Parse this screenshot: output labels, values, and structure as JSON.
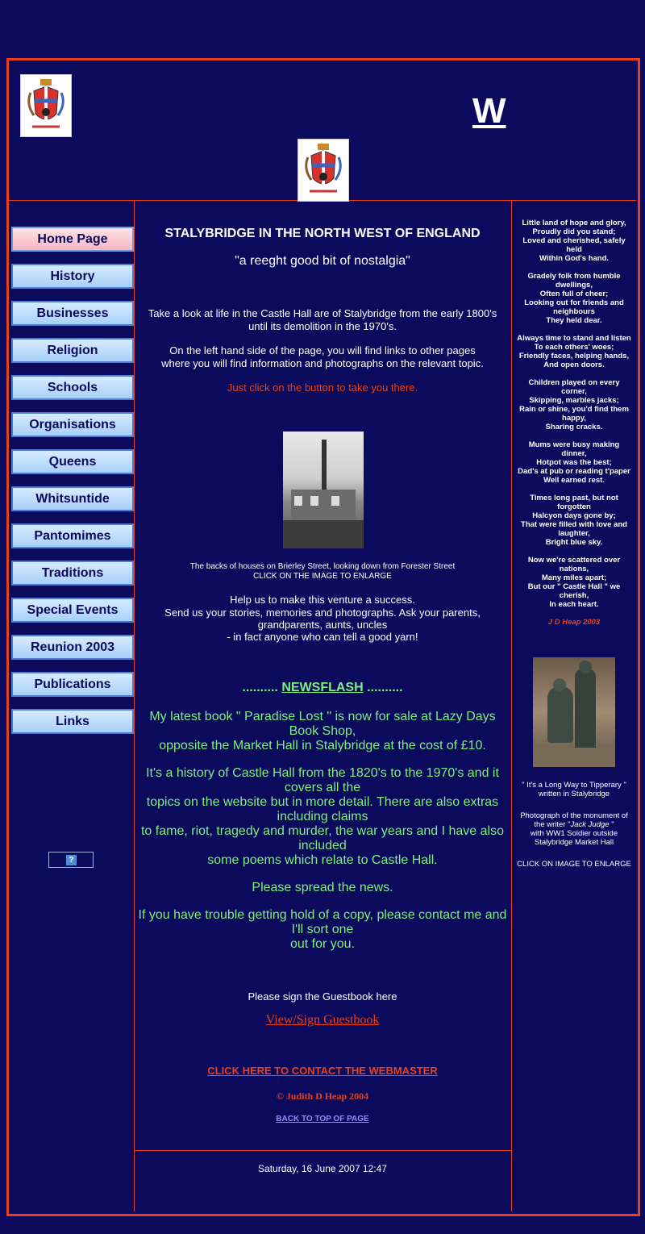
{
  "header": {
    "big_letter": "W"
  },
  "nav": [
    {
      "label": "Home Page",
      "active": true
    },
    {
      "label": "History"
    },
    {
      "label": "Businesses"
    },
    {
      "label": "Religion"
    },
    {
      "label": "Schools"
    },
    {
      "label": "Organisations"
    },
    {
      "label": "Queens"
    },
    {
      "label": "Whitsuntide"
    },
    {
      "label": "Pantomimes"
    },
    {
      "label": "Traditions"
    },
    {
      "label": "Special Events"
    },
    {
      "label": "Reunion 2003"
    },
    {
      "label": "Publications"
    },
    {
      "label": "Links"
    }
  ],
  "counter_badge": "?",
  "main": {
    "title": "STALYBRIDGE IN THE NORTH WEST OF ENGLAND",
    "subtitle": "\"a reeght good bit of nostalgia\"",
    "intro1a": "Take a look at life in the Castle Hall are of Stalybridge from the early 1800's",
    "intro1b": "until its demolition in the 1970's.",
    "intro2a": "On the left hand side of the page, you will find links to other pages",
    "intro2b": "where you will find information and photographs on the relevant topic.",
    "click_hint": "Just click on the button to take you there.",
    "caption1": "The backs of houses on Brierley Street, looking down from Forester Street",
    "caption2": "CLICK ON THE IMAGE TO ENLARGE",
    "help1": "Help us to make this venture a success.",
    "help2": "Send us your stories, memories and photographs. Ask your parents,",
    "help3": "grandparents, aunts, uncles",
    "help4": "- in fact anyone who can tell a good yarn!",
    "news_dots": "..........",
    "news_title": "NEWSFLASH",
    "news1": "My latest book \" Paradise Lost \" is now for sale at Lazy Days",
    "news2": "Book Shop,",
    "news3": "opposite the Market Hall in Stalybridge at the cost of £10.",
    "news4": "It's a history of Castle Hall from the 1820's to the 1970's and it",
    "news5": "covers all the",
    "news6": "topics on the website but in more detail. There are also extras",
    "news7": "including claims",
    "news8": "to fame, riot, tragedy and murder, the war years and I have also",
    "news9": "included",
    "news10": "some poems which relate to Castle Hall.",
    "news11": "Please spread the news.",
    "news12": "If you have trouble getting hold of a copy, please contact me and",
    "news13": "I'll sort one",
    "news14": "out for you.",
    "guest_prompt": "Please sign the Guestbook here",
    "guest_link": "View/Sign Guestbook",
    "contact_link": "CLICK HERE TO CONTACT THE WEBMASTER",
    "copyright": "©  Judith D Heap 2004",
    "back_top": "BACK TO TOP OF PAGE",
    "date": "Saturday, 16 June 2007 12:47"
  },
  "poem": {
    "lines": [
      "Little land of hope and glory,",
      "Proudly did you stand;",
      "Loved and cherished, safely",
      "held",
      "Within God's hand.",
      "",
      "Gradely folk from humble",
      "dwellings,",
      "Often full of cheer;",
      "Looking out for friends and",
      "neighbours",
      "They held dear.",
      "",
      "Always time to stand and listen",
      "To each others' woes;",
      "Friendly faces, helping hands,",
      "And open doors.",
      "",
      "Children played on every",
      "corner,",
      "Skipping, marbles jacks;",
      "Rain or shine, you'd find them",
      "happy,",
      "Sharing cracks.",
      "",
      "Mums were busy making",
      "dinner,",
      "Hotpot was the best;",
      "Dad's at pub or reading t'paper",
      "Well earned rest.",
      "",
      "Times long past, but not",
      "forgotten",
      "Halcyon days gone by;",
      "That were filled with love and",
      "laughter,",
      "Bright blue sky.",
      "",
      "Now we're scattered over",
      "nations,",
      "Many miles apart;",
      "But our \" Castle Hall \" we",
      "cherish,",
      "In each heart."
    ],
    "author": "J D Heap 2003"
  },
  "monument": {
    "cap1": "\" It's a Long Way to Tipperary \"",
    "cap2": "written in Stalybridge",
    "cap3": "Photograph of the monument of",
    "cap4a": "the writer \"",
    "cap4b": "Jack Judge",
    "cap4c": " \"",
    "cap5": "with WW1 Soldier outside",
    "cap6": "Stalybridge Market Hall",
    "cap7": "CLICK ON IMAGE TO ENLARGE"
  }
}
